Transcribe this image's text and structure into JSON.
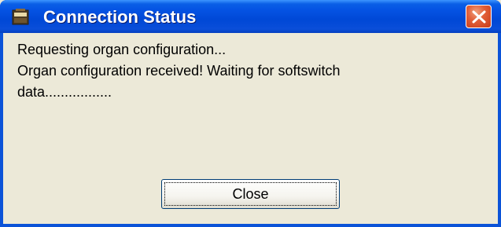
{
  "window": {
    "title": "Connection Status",
    "icon": "organ-app-icon",
    "close_icon": "close-icon"
  },
  "message": {
    "lines": [
      "Requesting organ configuration...",
      "Organ configuration received! Waiting for softswitch",
      "data................."
    ]
  },
  "buttons": {
    "close_label": "Close"
  },
  "colors": {
    "titlebar": "#0553e3",
    "client_bg": "#ece9d8",
    "close_button": "#e2603a",
    "title_text": "#ffffff"
  }
}
